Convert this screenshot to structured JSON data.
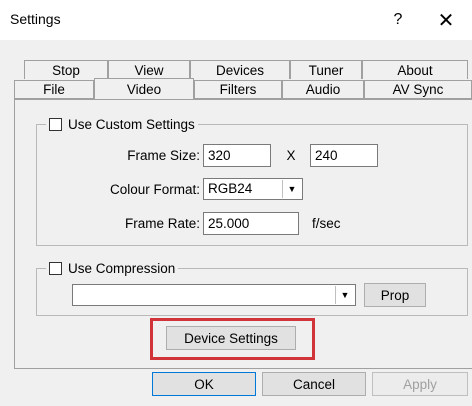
{
  "window": {
    "title": "Settings",
    "help_glyph": "?",
    "close_glyph": "✕"
  },
  "tabs": {
    "back_row": [
      "Stop",
      "View",
      "Devices",
      "Tuner",
      "About"
    ],
    "front_row": [
      "File",
      "Video",
      "Filters",
      "Audio",
      "AV Sync"
    ],
    "selected": "Video"
  },
  "custom_settings": {
    "checkbox_label": "Use Custom Settings",
    "checked": false,
    "frame_size_label": "Frame Size:",
    "width": "320",
    "times": "X",
    "height": "240",
    "colour_format_label": "Colour Format:",
    "colour_format": "RGB24",
    "frame_rate_label": "Frame Rate:",
    "frame_rate": "25.000",
    "frame_rate_unit": "f/sec"
  },
  "compression": {
    "checkbox_label": "Use Compression",
    "checked": false,
    "codec": "",
    "prop_button": "Prop"
  },
  "device_settings_button": "Device Settings",
  "footer": {
    "ok": "OK",
    "cancel": "Cancel",
    "apply": "Apply"
  },
  "colors": {
    "highlight": "#d13438",
    "panel_bg": "#f0f0f0"
  }
}
